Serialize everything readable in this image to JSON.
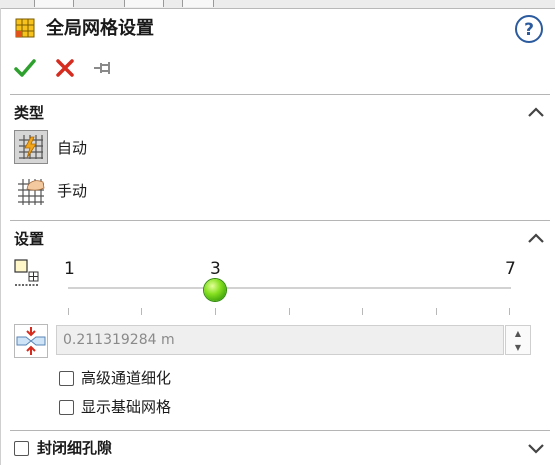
{
  "header": {
    "title": "全局网格设置",
    "help_icon": "help-icon",
    "accept_icon": "checkmark-icon",
    "cancel_icon": "close-icon",
    "pin_icon": "pushpin-icon"
  },
  "type_section": {
    "title": "类型",
    "options": [
      {
        "label": "自动",
        "icon": "auto-mesh-icon",
        "selected": true
      },
      {
        "label": "手动",
        "icon": "manual-mesh-icon",
        "selected": false
      }
    ]
  },
  "settings_section": {
    "title": "设置",
    "level_slider": {
      "min_label": "1",
      "value_label": "3",
      "max_label": "7",
      "min": 1,
      "max": 7,
      "value": 3
    },
    "min_gap_value": "0.211319284 m",
    "checkboxes": [
      {
        "label": "高级通道细化",
        "checked": false
      },
      {
        "label": "显示基础网格",
        "checked": false
      }
    ]
  },
  "close_gaps_section": {
    "label": "封闭细孔隙",
    "checked": false
  },
  "colors": {
    "accept": "#2ea02e",
    "cancel": "#d62b1f",
    "slider_knob": "#6ccf18",
    "rule": "#b5b5b5"
  }
}
